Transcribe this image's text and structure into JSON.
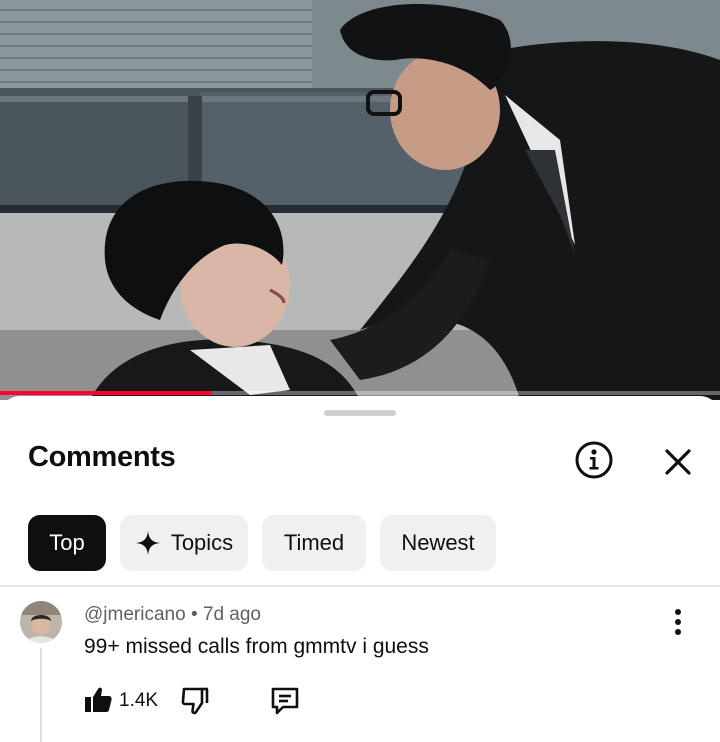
{
  "video": {
    "progress_fraction": 0.295,
    "accent_color": "#ff0033"
  },
  "comments_panel": {
    "title": "Comments",
    "info_icon": "info-icon",
    "close_icon": "close-icon"
  },
  "chips": [
    {
      "label": "Top",
      "active": true
    },
    {
      "label": "Topics",
      "icon": "sparkle-icon",
      "active": false
    },
    {
      "label": "Timed",
      "active": false
    },
    {
      "label": "Newest",
      "active": false
    }
  ],
  "comment": {
    "author": "@jmericano",
    "separator": "•",
    "age": "7d ago",
    "text": "99+ missed calls from gmmtv i guess",
    "likes": "1.4K",
    "like_icon": "thumbs-up-icon",
    "dislike_icon": "thumbs-down-icon",
    "reply_icon": "reply-icon",
    "more_icon": "more-vert-icon"
  }
}
